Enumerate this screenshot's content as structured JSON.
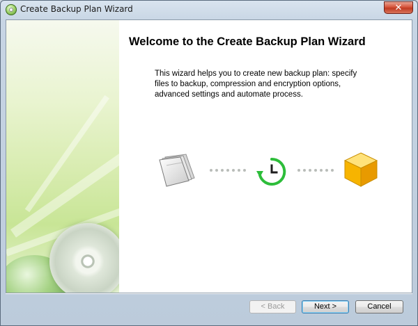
{
  "window": {
    "title": "Create Backup Plan Wizard",
    "close_label": "✕"
  },
  "content": {
    "heading": "Welcome to the Create Backup Plan Wizard",
    "description_lines": [
      "This wizard helps you to create new backup plan: specify",
      "files to backup, compression and encryption options,",
      "advanced settings and automate process."
    ]
  },
  "illustration": {
    "steps": [
      "documents-icon",
      "clock-restore-icon",
      "box-icon"
    ],
    "colors": {
      "clock": "#2dbd3a",
      "box": "#f4b400",
      "dots": "#b9bdb9"
    }
  },
  "buttons": {
    "back": "< Back",
    "next": "Next >",
    "cancel": "Cancel"
  }
}
